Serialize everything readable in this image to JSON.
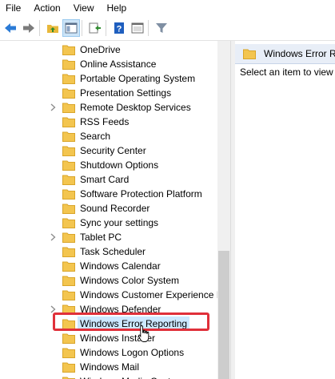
{
  "menu": [
    "File",
    "Action",
    "View",
    "Help"
  ],
  "tree": {
    "items": [
      {
        "label": "OneDrive",
        "expandable": false
      },
      {
        "label": "Online Assistance",
        "expandable": false
      },
      {
        "label": "Portable Operating System",
        "expandable": false
      },
      {
        "label": "Presentation Settings",
        "expandable": false
      },
      {
        "label": "Remote Desktop Services",
        "expandable": true
      },
      {
        "label": "RSS Feeds",
        "expandable": false
      },
      {
        "label": "Search",
        "expandable": false
      },
      {
        "label": "Security Center",
        "expandable": false
      },
      {
        "label": "Shutdown Options",
        "expandable": false
      },
      {
        "label": "Smart Card",
        "expandable": false
      },
      {
        "label": "Software Protection Platform",
        "expandable": false
      },
      {
        "label": "Sound Recorder",
        "expandable": false
      },
      {
        "label": "Sync your settings",
        "expandable": false
      },
      {
        "label": "Tablet PC",
        "expandable": true
      },
      {
        "label": "Task Scheduler",
        "expandable": false
      },
      {
        "label": "Windows Calendar",
        "expandable": false
      },
      {
        "label": "Windows Color System",
        "expandable": false
      },
      {
        "label": "Windows Customer Experience Improvement Program",
        "expandable": false
      },
      {
        "label": "Windows Defender",
        "expandable": true
      },
      {
        "label": "Windows Error Reporting",
        "expandable": false,
        "selected": true
      },
      {
        "label": "Windows Installer",
        "expandable": false
      },
      {
        "label": "Windows Logon Options",
        "expandable": false
      },
      {
        "label": "Windows Mail",
        "expandable": false
      },
      {
        "label": "Windows Media Center",
        "expandable": false
      }
    ]
  },
  "right_pane": {
    "header_title": "Windows Error Reporting",
    "hint": "Select an item to view its description."
  },
  "colors": {
    "selection": "#cce8ff",
    "highlight_box": "#e0303a",
    "folder": "#f3c54f"
  }
}
